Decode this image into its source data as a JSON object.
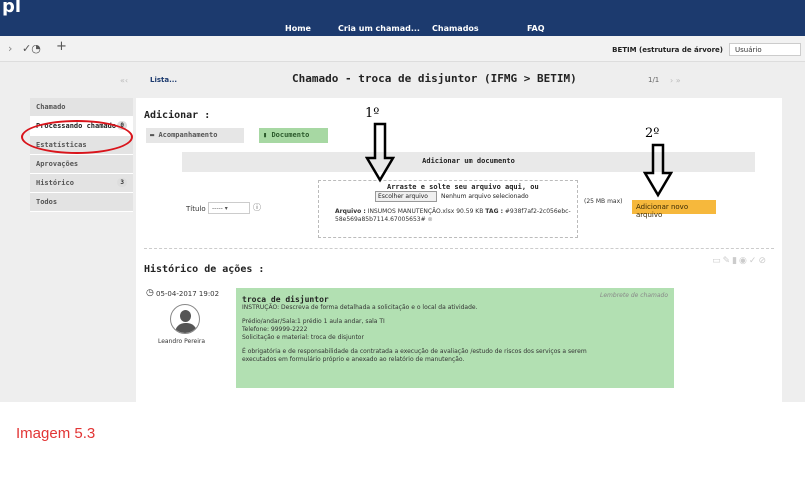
{
  "header": {
    "logo": "pl",
    "nav": [
      "Home",
      "Cria um chamad...",
      "Chamados",
      "FAQ"
    ],
    "entity": "BETIM (estrutura de árvore)",
    "user_select": "Usuário"
  },
  "titlebar": {
    "list_link": "Lista...",
    "title": "Chamado - troca de disjuntor (IFMG > BETIM)",
    "pager": "1/1"
  },
  "sidebar": {
    "items": [
      {
        "label": "Chamado",
        "badge": ""
      },
      {
        "label": "Processando chamado",
        "badge": "0"
      },
      {
        "label": "Estatísticas",
        "badge": ""
      },
      {
        "label": "Aprovações",
        "badge": ""
      },
      {
        "label": "Histórico",
        "badge": "3"
      },
      {
        "label": "Todos",
        "badge": ""
      }
    ]
  },
  "add": {
    "title": "Adicionar :",
    "acompanhamento": "Acompanhamento",
    "documento": "Documento",
    "doc_header": "Adicionar um documento",
    "titulo_label": "Título",
    "titulo_value": "-----",
    "dropzone_text": "Arraste e solte seu arquivo aqui, ou",
    "choose_button": "Escolher arquivo",
    "no_file": "Nenhum arquivo selecionado",
    "arquivo_label": "Arquivo :",
    "arquivo_value": "INSUMOS MANUTENÇÃO.xlsx 90.59 KB",
    "tag_label": "TAG :",
    "tag_value": "#938f7af2-2c056ebc-58e569a85b7114.67005653#",
    "size_limit": "(25 MB max)",
    "add_button": "Adicionar novo arquivo"
  },
  "history": {
    "title": "Histórico de ações :",
    "date": "05-04-2017 19:02",
    "author": "Leandro Pereira",
    "entry_tag": "Lembrete de chamado",
    "entry_title": "troca de disjuntor",
    "lines": [
      "INSTRUÇÃO: Descreva de forma detalhada a solicitação e o local da atividade.",
      "Prédio/andar/Sala:1 prédio 1 aula andar, sala TI",
      "Telefone: 99999-2222",
      "Solicitação e material: troca de disjuntor",
      "É obrigatória e de responsabilidade da contratada a execução de avaliação /estudo de riscos dos serviços a serem",
      "executados em formulário próprio e anexado ao relatório de manutenção."
    ]
  },
  "annotations": {
    "step1": "1º",
    "step2": "2º"
  },
  "caption": "Imagem 5.3"
}
